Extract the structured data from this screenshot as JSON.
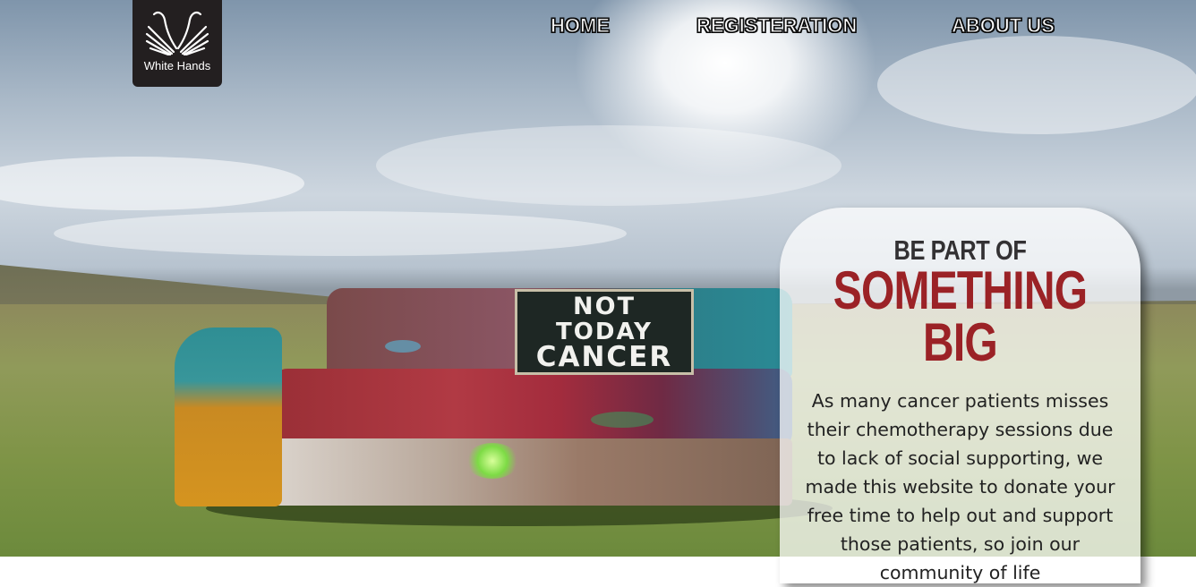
{
  "logo": {
    "text": "White Hands",
    "icon": "white-hands-logo-icon",
    "bg_color": "#231f20"
  },
  "nav": {
    "items": [
      {
        "label": "HOME"
      },
      {
        "label": "REGISTERATION"
      },
      {
        "label": "ABOUT US"
      }
    ]
  },
  "hero": {
    "sign_lines": [
      "NOT",
      "TODAY",
      "CANCER"
    ],
    "card": {
      "kicker": "BE PART OF",
      "title": "SOMETHING BIG",
      "body": "As many cancer patients misses their chemotherapy sessions due to lack of social supporting, we made this website to donate your free time to help out and support those patients, so join our community of life",
      "title_color": "#9b2226"
    }
  }
}
